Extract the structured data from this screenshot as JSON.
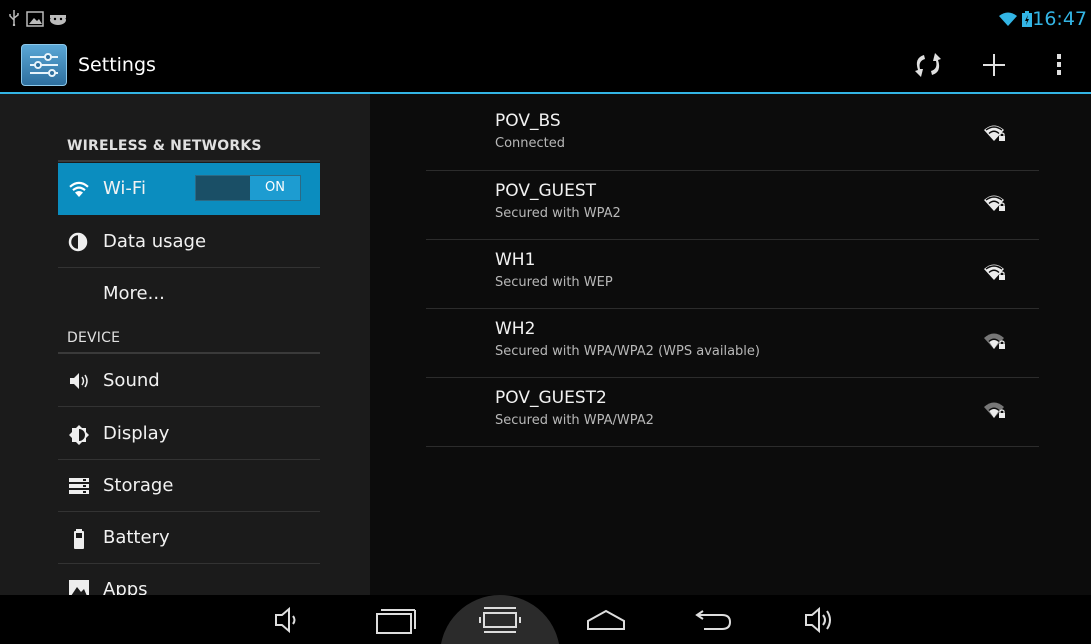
{
  "status_bar": {
    "time": "16:47",
    "left_icons": [
      "usb-icon",
      "image-notification-icon",
      "android-debug-icon"
    ],
    "right_icons": [
      "wifi-signal-icon",
      "battery-charging-icon"
    ]
  },
  "action_bar": {
    "title": "Settings",
    "actions": [
      "wps-icon",
      "add-network-icon",
      "overflow-menu-icon"
    ]
  },
  "sidebar": {
    "sections": [
      {
        "header": "WIRELESS & NETWORKS",
        "items": [
          {
            "label": "Wi-Fi",
            "icon": "wifi-icon",
            "toggle": "ON",
            "selected": true
          },
          {
            "label": "Data usage",
            "icon": "data-usage-icon"
          },
          {
            "label": "More...",
            "icon": ""
          }
        ]
      },
      {
        "header": "DEVICE",
        "items": [
          {
            "label": "Sound",
            "icon": "sound-icon"
          },
          {
            "label": "Display",
            "icon": "display-icon"
          },
          {
            "label": "Storage",
            "icon": "storage-icon"
          },
          {
            "label": "Battery",
            "icon": "battery-icon"
          },
          {
            "label": "Apps",
            "icon": "apps-icon"
          }
        ]
      }
    ]
  },
  "networks": [
    {
      "ssid": "POV_BS",
      "status": "Connected",
      "signal_icon": "wifi-lock-icon"
    },
    {
      "ssid": "POV_GUEST",
      "status": "Secured with WPA2",
      "signal_icon": "wifi-lock-icon"
    },
    {
      "ssid": "WH1",
      "status": "Secured with WEP",
      "signal_icon": "wifi-lock-icon"
    },
    {
      "ssid": "WH2",
      "status": "Secured with WPA/WPA2 (WPS available)",
      "signal_icon": "wifi-lock-icon"
    },
    {
      "ssid": "POV_GUEST2",
      "status": "Secured with WPA/WPA2",
      "signal_icon": "wifi-lock-icon"
    }
  ],
  "nav_bar": {
    "buttons": [
      "volume-down-icon",
      "home-tray-icon",
      "recent-apps-icon",
      "home-icon",
      "back-icon",
      "volume-up-icon"
    ]
  },
  "colors": {
    "accent": "#33b5e5",
    "selected_item": "#0b8dbf",
    "toggle_on": "#1d9cd1"
  }
}
